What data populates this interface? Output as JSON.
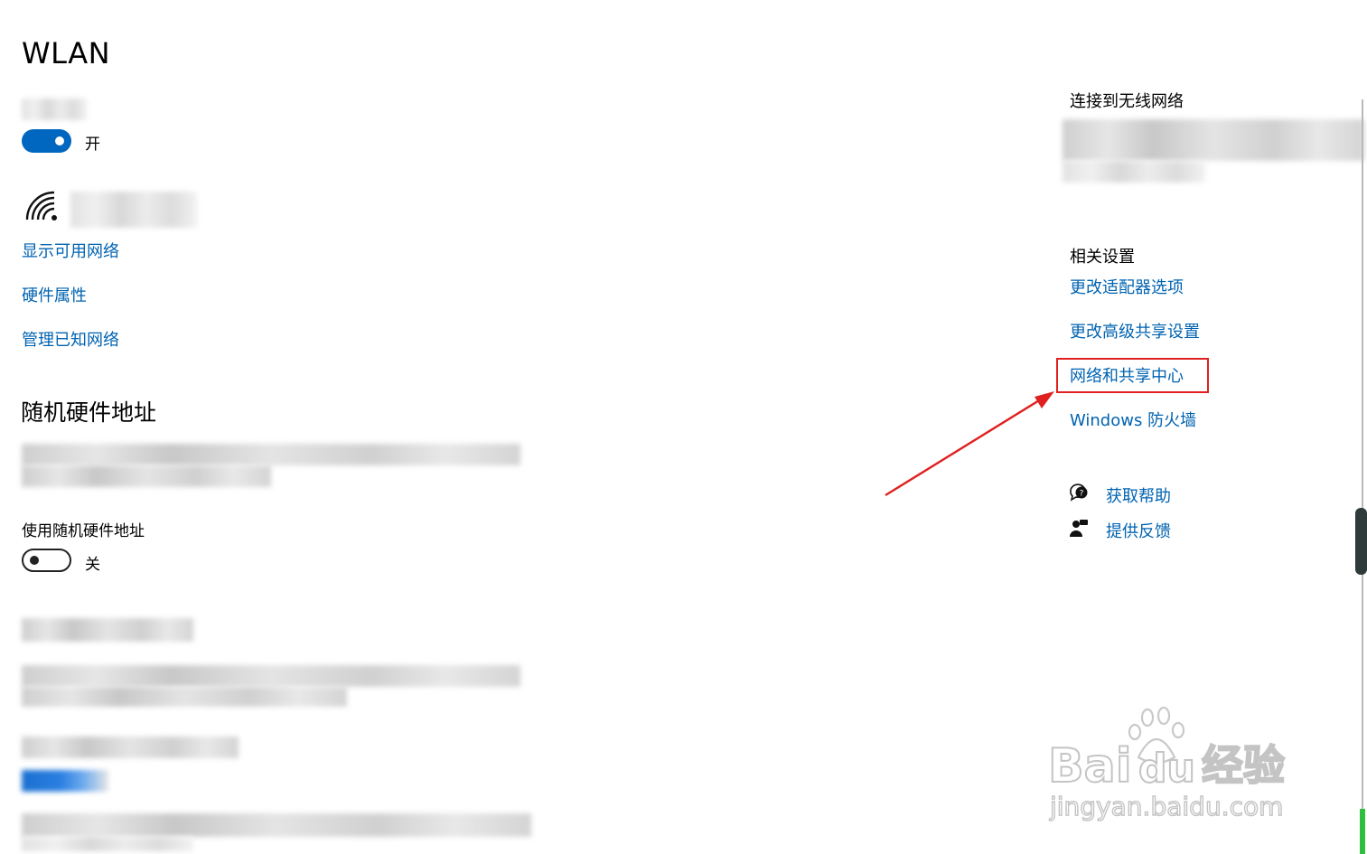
{
  "page": {
    "title": "WLAN"
  },
  "wlan_toggle": {
    "state_label": "开"
  },
  "links_left": {
    "show_networks": "显示可用网络",
    "hardware_properties": "硬件属性",
    "manage_known": "管理已知网络"
  },
  "random_mac": {
    "heading": "随机硬件地址",
    "use_label": "使用随机硬件地址",
    "toggle_state_label": "关"
  },
  "sidebar": {
    "connect_heading": "连接到无线网络",
    "related_heading": "相关设置",
    "links": {
      "adapter_options": "更改适配器选项",
      "advanced_sharing": "更改高级共享设置",
      "network_center": "网络和共享中心",
      "firewall": "Windows 防火墙"
    },
    "help": {
      "get_help": "获取帮助",
      "feedback": "提供反馈"
    }
  },
  "watermark": {
    "brand": "Baidu经验",
    "url": "jingyan.baidu.com"
  },
  "colors": {
    "accent": "#0067c0",
    "link": "#0063b1",
    "annotation": "#e02020"
  }
}
